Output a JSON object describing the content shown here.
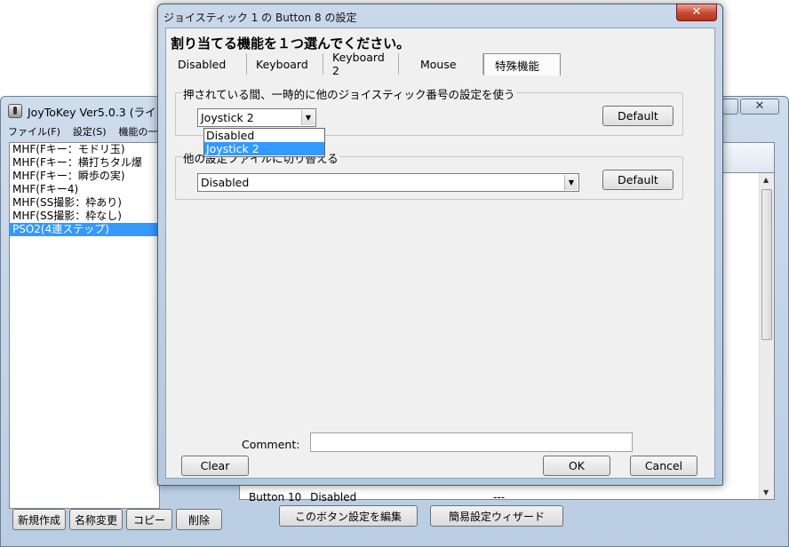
{
  "main_window": {
    "title": "JoyToKey Ver5.0.3 (ライ",
    "menu": [
      "ファイル(F)",
      "設定(S)",
      "機能の一"
    ],
    "close_symbol": "✕",
    "profiles": [
      "MHF(Fキー：モドリ玉)",
      "MHF(Fキー：横打ちタル爆",
      "MHF(Fキー：瞬歩の実)",
      "MHF(Fキー4)",
      "MHF(SS撮影：枠あり)",
      "MHF(SS撮影：枠なし)",
      "PSO2(4連ステップ)"
    ],
    "selected_profile_index": 6,
    "partial_row": {
      "button": "Button 10",
      "value": "Disabled",
      "dash": "---"
    },
    "bottom_buttons": {
      "new": "新規作成",
      "rename": "名称変更",
      "copy": "コピー",
      "delete": "削除",
      "edit": "このボタン設定を編集",
      "wizard": "簡易設定ウィザード"
    }
  },
  "dialog": {
    "title": "ジョイスティック 1 の Button 8 の設定",
    "close_symbol": "✕",
    "heading": "割り当てる機能を１つ選んでください。",
    "tabs": [
      "Disabled",
      "Keyboard",
      "Keyboard 2",
      "Mouse",
      "特殊機能"
    ],
    "active_tab_index": 4,
    "group1": {
      "label": "押されている間、一時的に他のジョイスティック番号の設定を使う",
      "value": "Joystick 2",
      "options": [
        "Disabled",
        "Joystick 2"
      ],
      "highlighted_option": 1,
      "default_label": "Default"
    },
    "group2": {
      "label": "他の設定ファイルに切り替える",
      "value": "Disabled",
      "default_label": "Default"
    },
    "comment_label": "Comment:",
    "comment_value": "",
    "clear_label": "Clear",
    "ok_label": "OK",
    "cancel_label": "Cancel"
  }
}
